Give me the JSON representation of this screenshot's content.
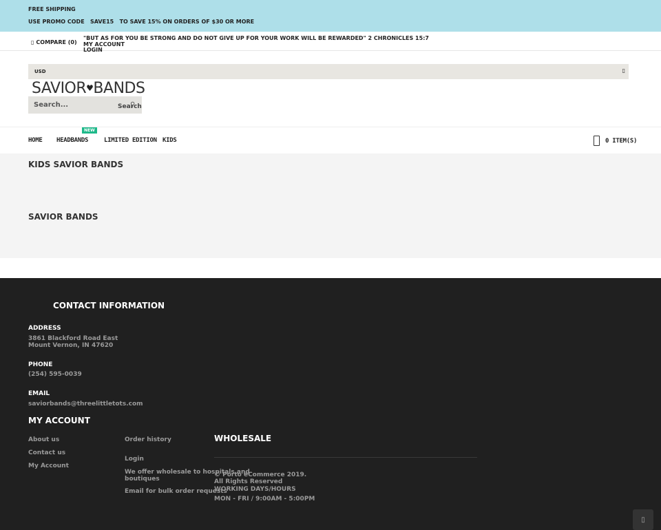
{
  "promo": {
    "line1": "FREE SHIPPING",
    "line2": "USE PROMO CODE   SAVE15   TO SAVE 15% ON ORDERS OF $30 OR MORE"
  },
  "toprow": {
    "compare_label": "COMPARE (0)",
    "quote": "\"BUT AS FOR YOU BE STRONG AND DO NOT GIVE UP FOR YOUR WORK WILL BE REWARDED\" 2 CHRONICLES 15:7",
    "my_account": "MY ACCOUNT",
    "login": "LOGIN"
  },
  "currency": {
    "selected": "USD"
  },
  "logo": {
    "left": "SAVIOR",
    "right": "BANDS",
    "heart": "♥"
  },
  "search": {
    "placeholder": "Search...",
    "button_label": "Search"
  },
  "nav": {
    "items": [
      "HOME",
      "HEADBANDS",
      "LIMITED EDITION",
      "KIDS"
    ],
    "new_badge": "NEW"
  },
  "cart": {
    "label": "0 ITEM(S)"
  },
  "content": {
    "heading1": "KIDS SAVIOR BANDS",
    "heading2": "SAVIOR BANDS"
  },
  "footer": {
    "contact_title": "CONTACT INFORMATION",
    "address_label": "ADDRESS",
    "address_line1": "3861 Blackford Road East",
    "address_line2": "Mount Vernon, IN 47620",
    "phone_label": "PHONE",
    "phone": "(254) 595-0039",
    "email_label": "EMAIL",
    "email": "saviorbands@threelittletots.com",
    "account_title": "MY ACCOUNT",
    "account_links": [
      "About us",
      "Contact us",
      "My Account",
      "Order history",
      "Login"
    ],
    "wholesale_title": "WHOLESALE",
    "wholesale_line1": "We offer wholesale to hospitals and boutiques",
    "wholesale_line2": "Email for bulk order requests",
    "copyright": "© Porto eCommerce 2019. All Rights Reserved",
    "hours_label": "WORKING DAYS/HOURS",
    "hours": "MON - FRI / 9:00AM - 5:00PM"
  }
}
